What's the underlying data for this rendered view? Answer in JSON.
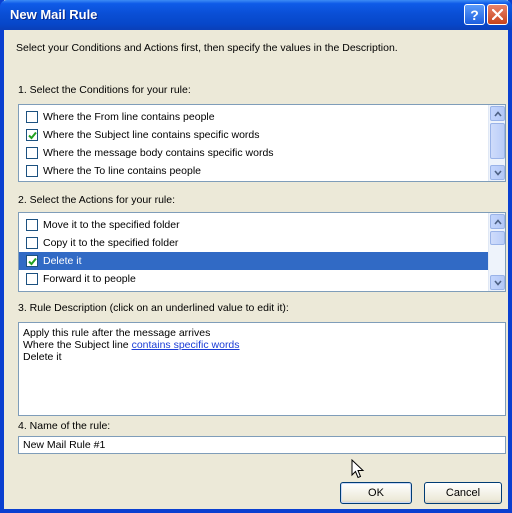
{
  "window": {
    "title": "New Mail Rule",
    "help_glyph": "?"
  },
  "intro": "Select your Conditions and Actions first, then specify the values in the Description.",
  "conditions": {
    "label": "1. Select the Conditions for your rule:",
    "items": [
      {
        "label": "Where the From line contains people",
        "checked": false
      },
      {
        "label": "Where the Subject line contains specific words",
        "checked": true
      },
      {
        "label": "Where the message body contains specific words",
        "checked": false
      },
      {
        "label": "Where the To line contains people",
        "checked": false
      }
    ]
  },
  "actions": {
    "label": "2. Select the Actions for your rule:",
    "items": [
      {
        "label": "Move it to the specified folder",
        "checked": false
      },
      {
        "label": "Copy it to the specified folder",
        "checked": false
      },
      {
        "label": "Delete it",
        "checked": true,
        "selected": true
      },
      {
        "label": "Forward it to people",
        "checked": false
      }
    ]
  },
  "description": {
    "label": "3. Rule Description (click on an underlined value to edit it):",
    "line1": "Apply this rule after the message arrives",
    "line2_prefix": "Where the Subject line ",
    "line2_link": "contains specific words",
    "line3": "Delete it"
  },
  "name": {
    "label": "4. Name of the rule:",
    "value": "New Mail Rule #1"
  },
  "buttons": {
    "ok": "OK",
    "cancel": "Cancel"
  },
  "colors": {
    "titlebar": "#0a4fd6",
    "selection": "#316ac5",
    "link": "#1a3cd6",
    "dialog_bg": "#ece9d8"
  }
}
